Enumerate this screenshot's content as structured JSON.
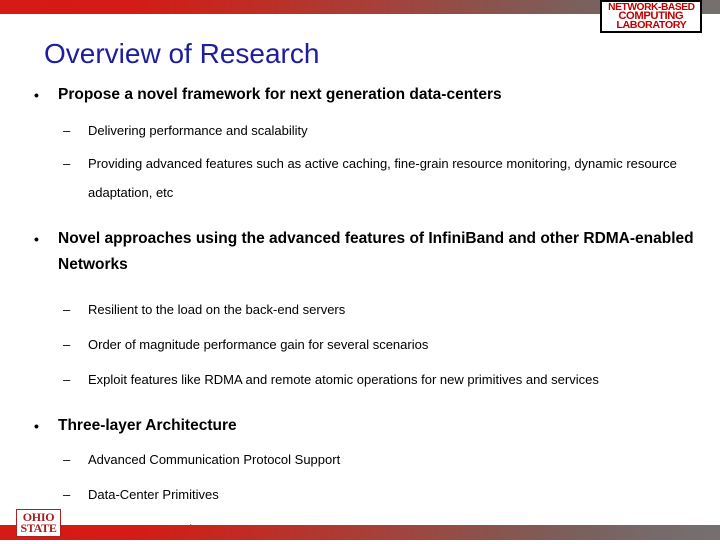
{
  "slide": {
    "title": "Overview of Research",
    "title_color": "#1d1d9e",
    "accent_color": "#d61a14",
    "bar_end_color": "#75706f"
  },
  "logos": {
    "nbcl": {
      "line1": "NETWORK-BASED",
      "line2": "COMPUTING",
      "line3": "LABORATORY",
      "color": "#c00000"
    },
    "osu": {
      "line1": "OHIO",
      "line2": "STATE",
      "color": "#a81c20"
    }
  },
  "markers": {
    "level1": "•",
    "level2": "–"
  },
  "content": [
    {
      "level": 1,
      "text": "Propose a novel framework for next generation data-centers"
    },
    {
      "level": 2,
      "text": "Delivering performance and scalability"
    },
    {
      "level": 2,
      "text": "Providing advanced features such as active caching, fine-grain resource monitoring, dynamic resource adaptation, etc"
    },
    {
      "level": 1,
      "text": "Novel approaches using the advanced features of InfiniBand and other RDMA-enabled Networks"
    },
    {
      "level": 2,
      "text": "Resilient to the load on the back-end servers"
    },
    {
      "level": 2,
      "text": "Order of magnitude performance gain for several scenarios"
    },
    {
      "level": 2,
      "text": "Exploit features like RDMA and remote atomic operations for new primitives and services"
    },
    {
      "level": 1,
      "text": "Three-layer Architecture"
    },
    {
      "level": 2,
      "text": "Advanced Communication Protocol Support"
    },
    {
      "level": 2,
      "text": "Data-Center Primitives"
    },
    {
      "level": 2,
      "text": "Data-Center Services"
    }
  ]
}
